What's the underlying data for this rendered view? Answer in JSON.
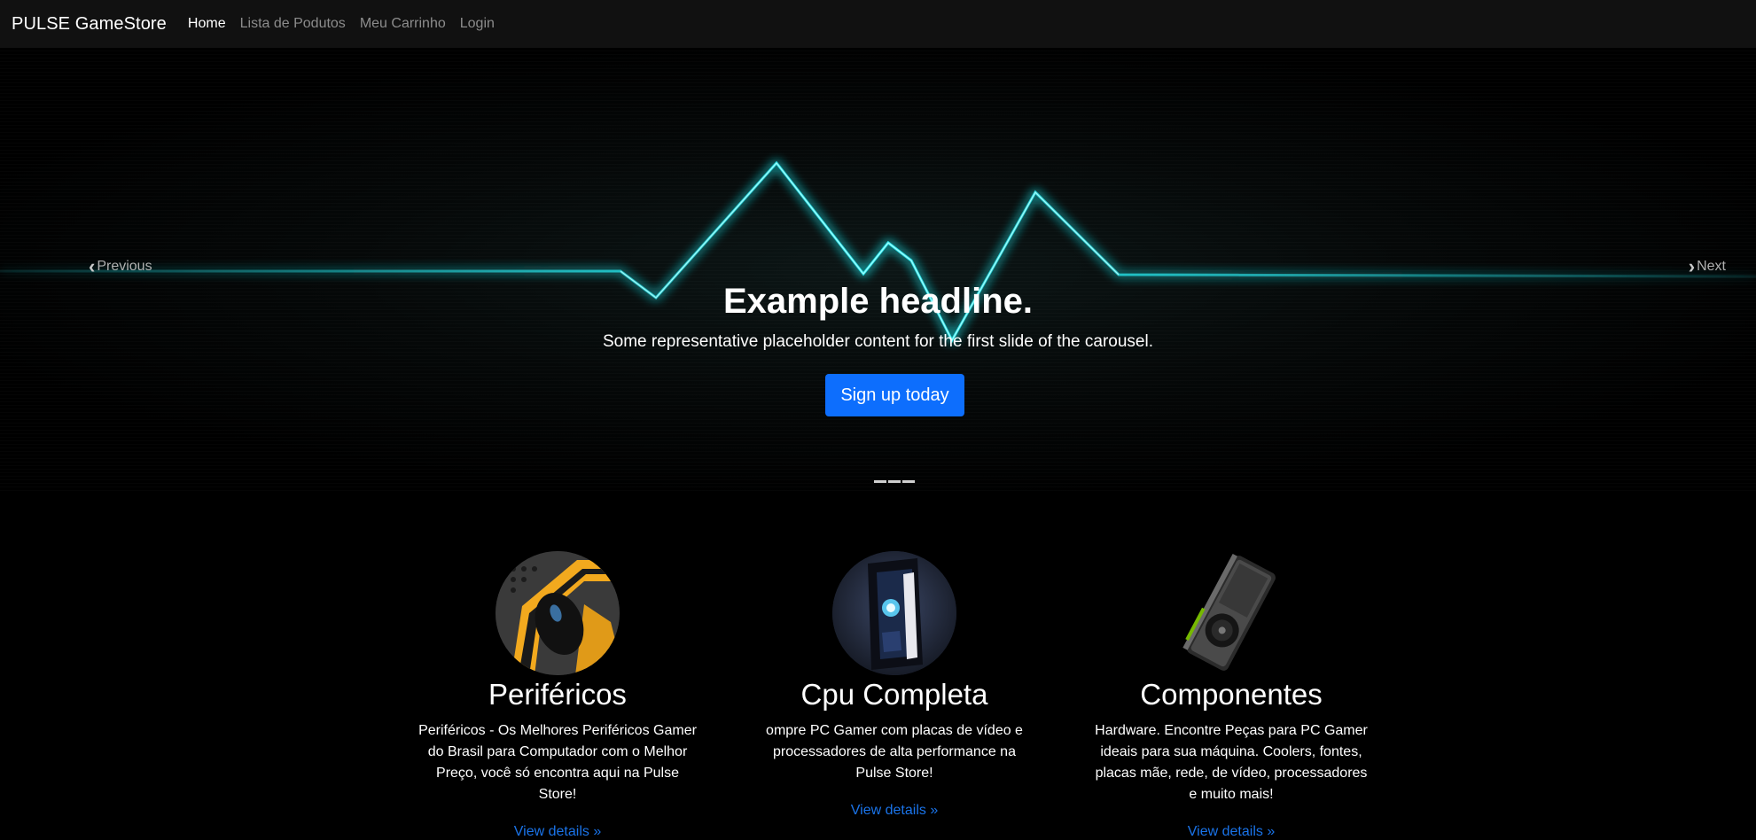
{
  "navbar": {
    "brand": "PULSE GameStore",
    "links": [
      "Home",
      "Lista de Podutos",
      "Meu Carrinho",
      "Login"
    ]
  },
  "carousel": {
    "prev_label": "Previous",
    "next_label": "Next",
    "headline": "Example headline.",
    "subtitle": "Some representative placeholder content for the first slide of the carousel.",
    "button_label": "Sign up today",
    "indicator_count": 3,
    "pulse_color": "#28e8ee"
  },
  "features": [
    {
      "image_icon": "gaming-mouse-image",
      "title": "Periféricos",
      "text": "Periféricos - Os Melhores Periféricos Gamer do Brasil para Computador com o Melhor Preço, você só encontra aqui na Pulse Store!",
      "link": "View details »"
    },
    {
      "image_icon": "pc-case-image",
      "title": "Cpu Completa",
      "text": "ompre PC Gamer com placas de vídeo e processadores de alta performance na Pulse Store!",
      "link": "View details »"
    },
    {
      "image_icon": "graphics-card-image",
      "title": "Componentes",
      "text": "Hardware. Encontre Peças para PC Gamer ideais para sua máquina. Coolers, fontes, placas mãe, rede, de vídeo, processadores e muito mais!",
      "link": "View details »"
    }
  ],
  "colors": {
    "primary": "#0d6efd",
    "link": "#1a73e8",
    "navbar_bg": "#111111"
  }
}
